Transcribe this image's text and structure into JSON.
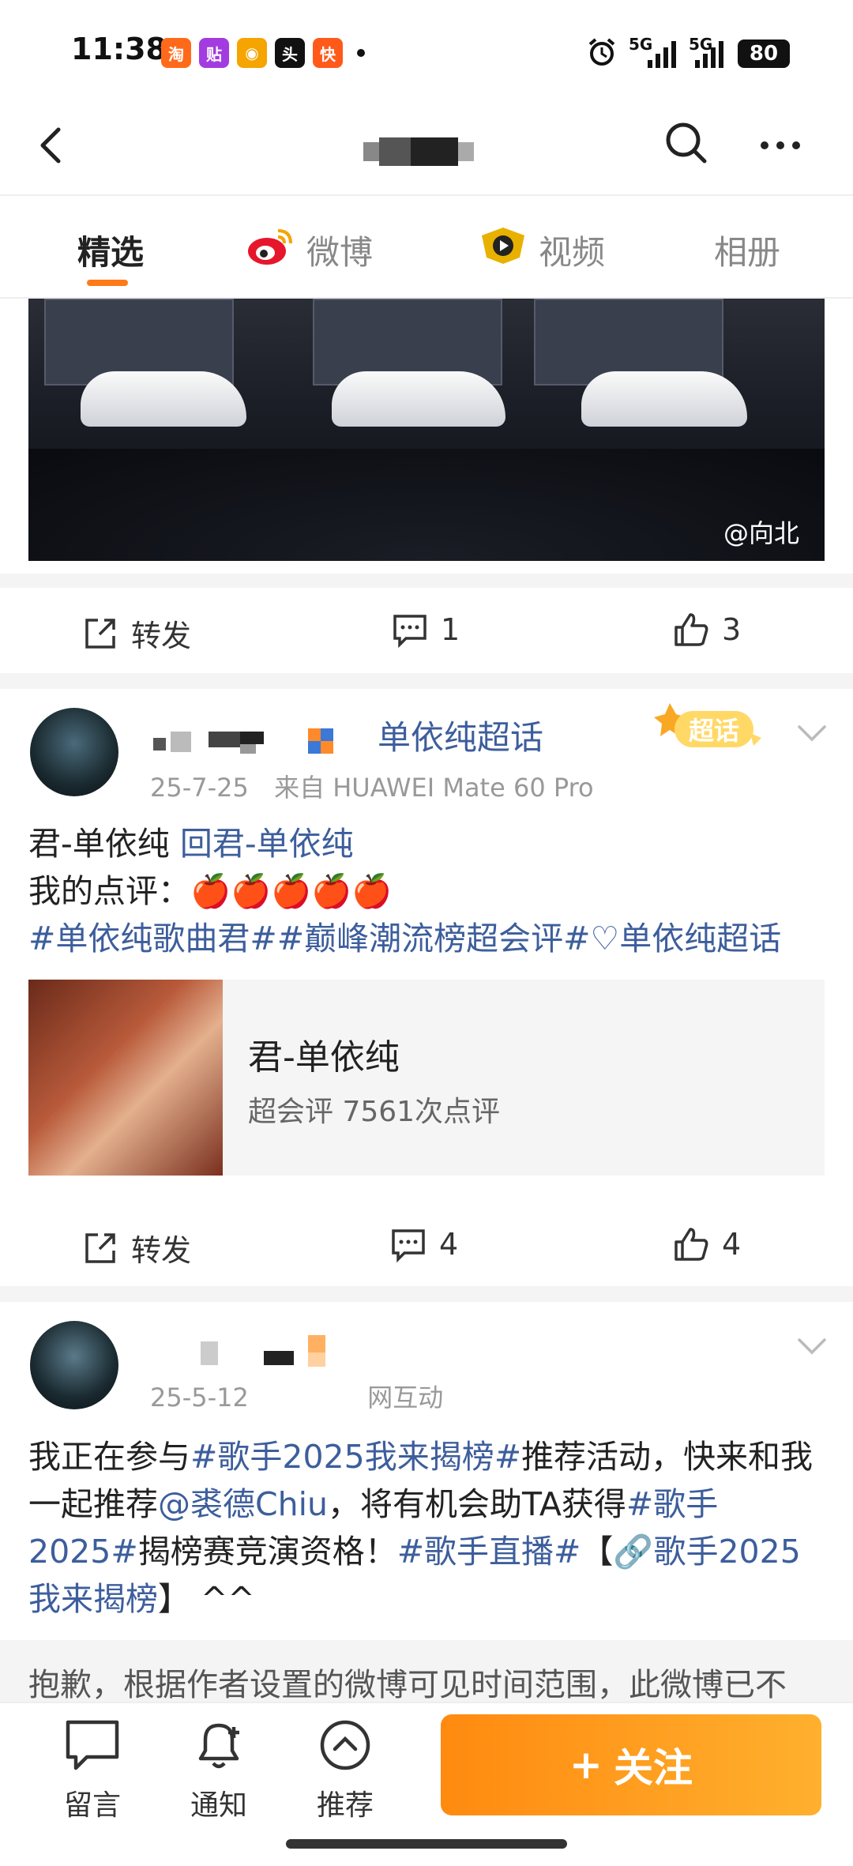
{
  "status_bar": {
    "time": "11:38",
    "notif_icons": [
      "taobao",
      "tieba",
      "weibo",
      "toutiao",
      "kuaishou"
    ],
    "net1": "5G",
    "net2": "5G",
    "battery": "80"
  },
  "tabs": [
    {
      "label": "精选",
      "active": true
    },
    {
      "label": "微博"
    },
    {
      "label": "视频"
    },
    {
      "label": "相册"
    }
  ],
  "post0": {
    "watermark": "@向北",
    "repost": "转发",
    "comments": "1",
    "likes": "3"
  },
  "post1": {
    "supertopic": "单依纯超话",
    "badge": "超话",
    "date": "25-7-25",
    "source": "来自 HUAWEI Mate 60 Pro",
    "line1_text": "君-单依纯 ",
    "line1_link": "回君-单依纯",
    "line2": "我的点评：",
    "apples": "🍎🍎🍎🍎🍎",
    "tag1": "#单依纯歌曲君#",
    "tag2": "#巅峰潮流榜超会评#",
    "tag3": "♡单依纯超话",
    "card_title": "君-单依纯",
    "card_sub": "超会评 7561次点评",
    "repost": "转发",
    "comments": "4",
    "likes": "4"
  },
  "post2": {
    "date": "25-5-12",
    "source": "网互动",
    "t1": "我正在参与",
    "l1": "#歌手2025我来揭榜#",
    "t2": "推荐活动，快来和我一起推荐",
    "l2": "@裘德Chiu",
    "t3": "，将有机会助TA获得",
    "l3": "#歌手2025#",
    "t4": "揭榜赛竞演资格！",
    "l4": "#歌手直播#",
    "t5": "【",
    "l5": "🔗歌手2025我来揭榜",
    "t6": "】 ^^",
    "hidden": "抱歉，根据作者设置的微博可见时间范围，此微博已不"
  },
  "bottom_bar": {
    "comment": "留言",
    "notify": "通知",
    "recommend": "推荐",
    "follow": "关注",
    "follow_plus": "+"
  }
}
